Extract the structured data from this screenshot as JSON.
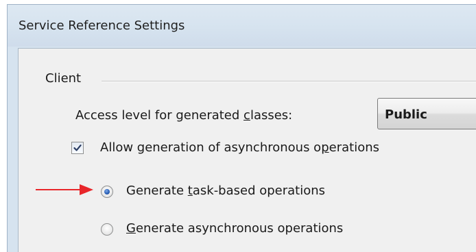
{
  "window": {
    "title": "Service Reference Settings"
  },
  "client_group": {
    "label": "Client",
    "access_level": {
      "label_before": "Access level for generated ",
      "label_mnemonic": "c",
      "label_after": "lasses:",
      "selected_value": "Public"
    },
    "allow_async": {
      "label_before": "Allow generation of asynchronous o",
      "label_mnemonic": "p",
      "label_after": "erations",
      "checked": true
    },
    "radios": [
      {
        "label_before": "Generate ",
        "label_mnemonic": "t",
        "label_after": "ask-based operations",
        "selected": true
      },
      {
        "label_before": "",
        "label_mnemonic": "G",
        "label_after": "enerate asynchronous operations",
        "selected": false
      }
    ]
  },
  "colors": {
    "annotation_arrow": "#e8262a",
    "radio_selected": "#2c62b8"
  }
}
